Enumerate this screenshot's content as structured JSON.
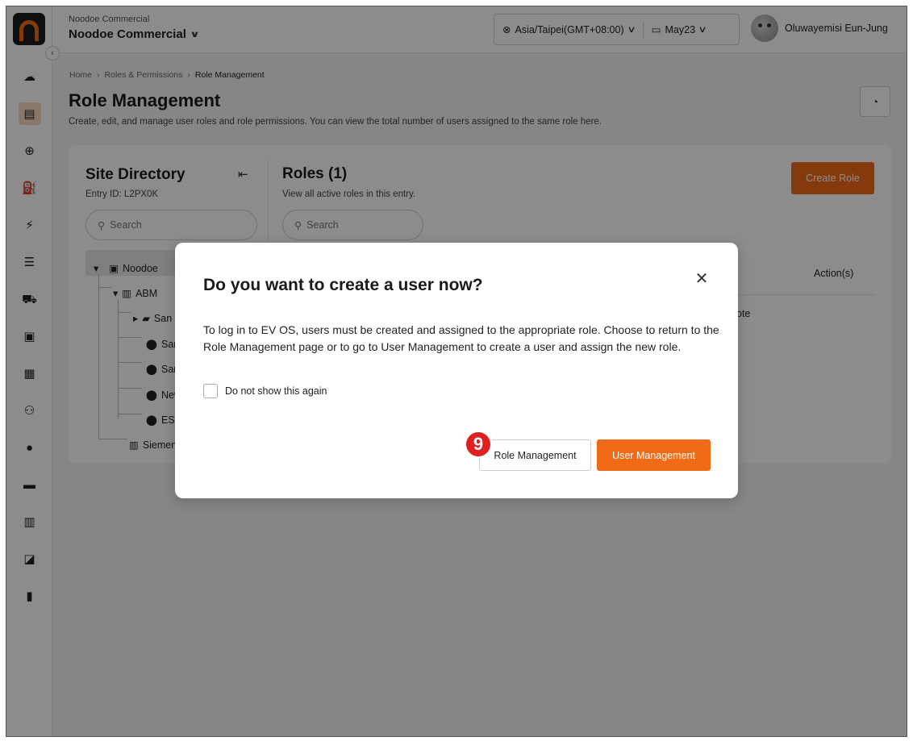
{
  "header": {
    "org_small": "Noodoe Commercial",
    "org_main": "Noodoe Commercial",
    "timezone": "Asia/Taipei(GMT+08:00)",
    "date": "May23",
    "user_name": "Oluwayemisi Eun-Jung"
  },
  "sidebar": {
    "items": [
      {
        "icon": "dashboard-icon",
        "glyph": "☁"
      },
      {
        "icon": "role-card-icon",
        "glyph": "▤",
        "active": true
      },
      {
        "icon": "globe-icon",
        "glyph": "⊕"
      },
      {
        "icon": "charger-icon",
        "glyph": "⛽"
      },
      {
        "icon": "lightning-icon",
        "glyph": "⚡"
      },
      {
        "icon": "table-icon",
        "glyph": "☰"
      },
      {
        "icon": "car-icon",
        "glyph": "⛟"
      },
      {
        "icon": "wifi-card-icon",
        "glyph": "▣"
      },
      {
        "icon": "qr-grid-icon",
        "glyph": "▦"
      },
      {
        "icon": "users-icon",
        "glyph": "⚇"
      },
      {
        "icon": "user-icon",
        "glyph": "●"
      },
      {
        "icon": "ticket-icon",
        "glyph": "▬"
      },
      {
        "icon": "building-icon",
        "glyph": "▥"
      },
      {
        "icon": "chart-icon",
        "glyph": "◪"
      },
      {
        "icon": "document-icon",
        "glyph": "▮"
      }
    ]
  },
  "breadcrumb": {
    "home": "Home",
    "parent": "Roles & Permissions",
    "current": "Role Management"
  },
  "page": {
    "title": "Role Management",
    "description": "Create, edit, and manage user roles and role permissions. You can view the total number of users assigned to the same role here."
  },
  "site_directory": {
    "title": "Site Directory",
    "entry_id": "Entry ID: L2PX0K",
    "search_placeholder": "Search",
    "tree": {
      "root": "Noodoe",
      "abm": "ABM",
      "child1": "San",
      "child2": "San",
      "child3": "San",
      "child4": "New",
      "child5": "ESP",
      "siemens": "Siemen"
    }
  },
  "roles": {
    "title": "Roles (1)",
    "description": "View all active roles in this entry.",
    "search_placeholder": "Search",
    "create_button": "Create Role",
    "column_action": "Action(s)",
    "row_fragment": "ote"
  },
  "modal": {
    "title": "Do you want to create a user now?",
    "body": "To log in to EV OS, users must be created and assigned to the appropriate role. Choose to return to the Role Management page or to go to User Management to create a user and assign the new role.",
    "checkbox_label": "Do not show this again",
    "role_button": "Role Management",
    "user_button": "User Management",
    "step_badge": "9"
  },
  "colors": {
    "accent": "#f16b17",
    "badge": "#e02020"
  }
}
